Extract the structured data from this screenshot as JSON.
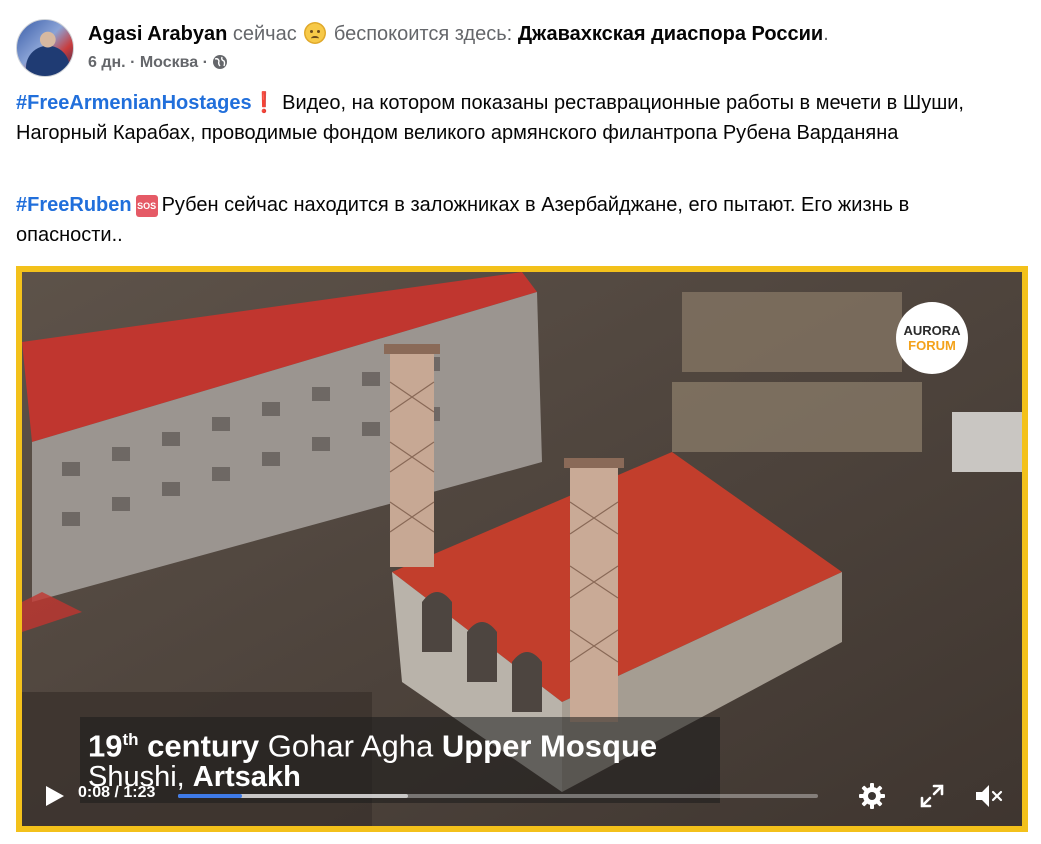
{
  "post": {
    "author": "Agasi Arabyan",
    "time_word": "сейчас",
    "feeling": "беспокоится здесь:",
    "group": "Джавахкская диаспора России",
    "group_suffix": ".",
    "age": "6 дн.",
    "location": "Москва",
    "separator": "·",
    "paragraph1": {
      "hashtag": "#FreeArmenianHostages",
      "emoji": "❗",
      "text": "Видео, на котором показаны реставрационные работы в мечети в Шуши, Нагорный Карабах, проводимые фондом великого армянского филантропа Рубена Варданяна"
    },
    "paragraph2": {
      "hashtag": "#FreeRuben",
      "sos": "SOS",
      "text": "Рубен сейчас находится в заложниках в Азербайджане, его пытают. Его жизнь в опасности.."
    }
  },
  "video": {
    "logo_line1": "AURORA",
    "logo_line2": "FORUM",
    "caption": {
      "line1_num": "19",
      "line1_sup": "th",
      "line1_bold1": "century",
      "line1_light": "Gohar Agha",
      "line1_bold2": "Upper Mosque",
      "line2_light": "Shushi,",
      "line2_bold": "Artsakh"
    },
    "time": "0:08 / 1:23",
    "progress_played": 0.1,
    "progress_buffered": 0.36
  },
  "colors": {
    "hashtag": "#216fdb",
    "frame": "#f3c11b",
    "progress": "#3e7ae8"
  }
}
